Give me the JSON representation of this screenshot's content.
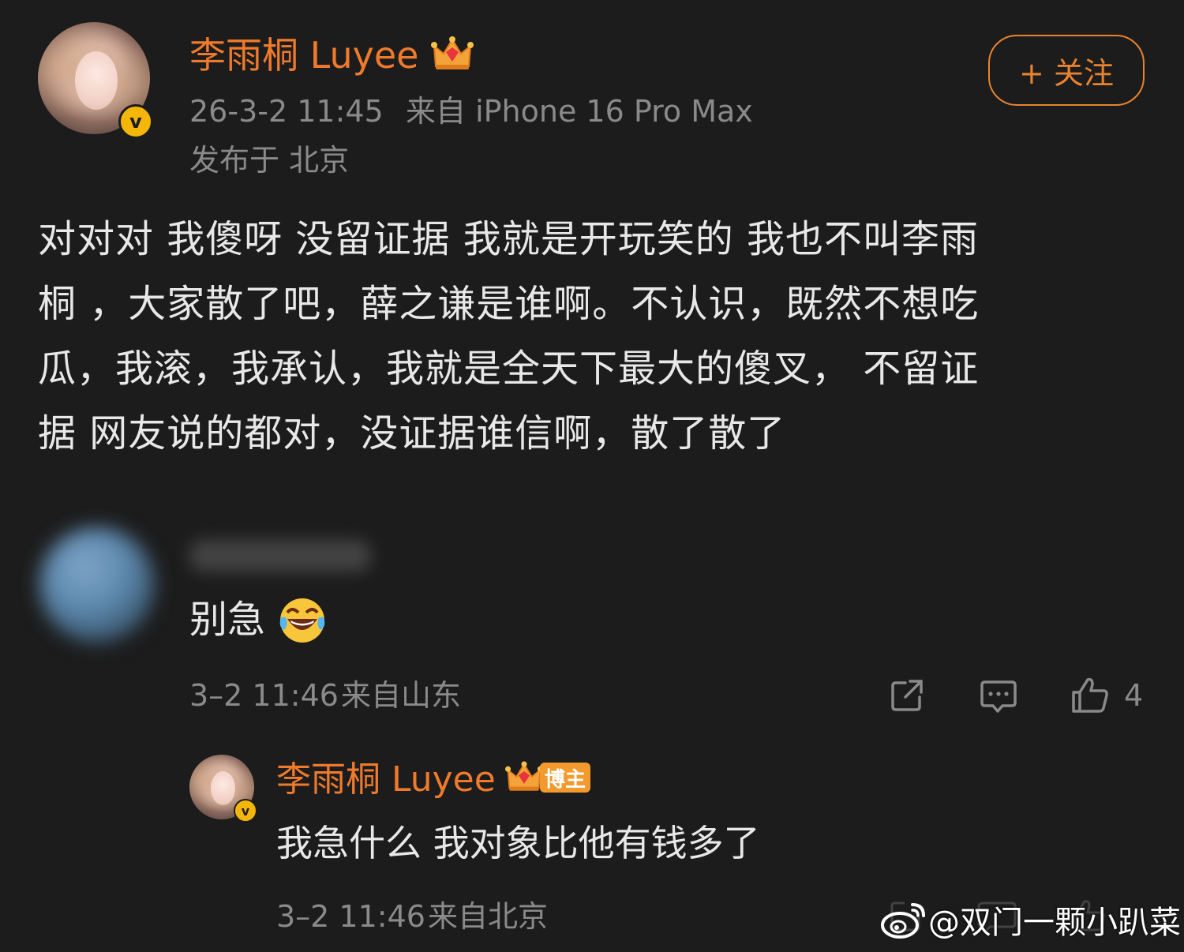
{
  "post": {
    "author_name": "李雨桐 Luyee",
    "verified_mark": "v",
    "timestamp": "26-3-2 11:45",
    "source": "来自 iPhone 16 Pro Max",
    "location": "发布于 北京",
    "follow_label": "+ 关注",
    "body_lines": [
      "对对对 我傻呀 没留证据 我就是开玩笑的 我也不叫李雨",
      "桐 ，大家散了吧，薛之谦是谁啊。不认识，既然不想吃",
      "瓜，我滚，我承认，我就是全天下最大的傻叉， 不留证",
      "据 网友说的都对，没证据谁信啊，散了散了"
    ]
  },
  "comment": {
    "text": "别急",
    "emoji": "😂",
    "timestamp": "3–2 11:46",
    "source": "来自山东",
    "like_count": "4"
  },
  "reply": {
    "author_name": "李雨桐 Luyee",
    "host_tag": "博主",
    "text": "我急什么 我对象比他有钱多了",
    "timestamp": "3–2 11:46",
    "source": "来自北京"
  },
  "watermark": {
    "text": "@双门一颗小趴菜"
  },
  "colors": {
    "background": "#1c1c1c",
    "accent_orange": "#f07a2c",
    "verified_yellow": "#f5b60a",
    "meta_grey": "#8a8a8a"
  },
  "icons": [
    "crown-icon",
    "share-icon",
    "comment-icon",
    "like-icon",
    "weibo-logo-icon"
  ]
}
